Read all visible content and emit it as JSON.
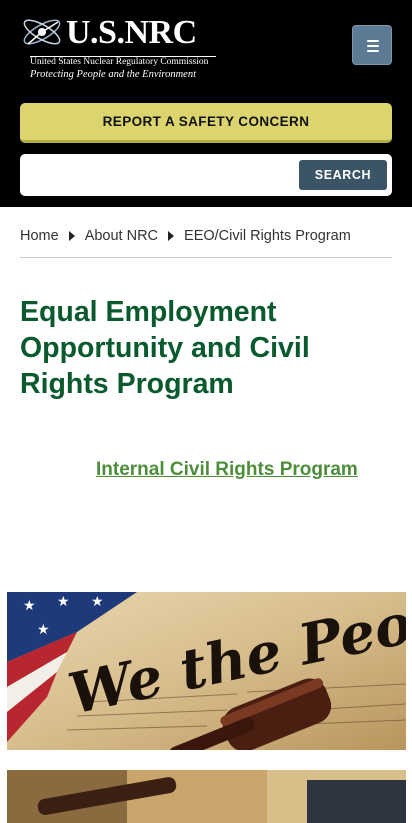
{
  "header": {
    "logo": {
      "wordmark": "U.S.NRC",
      "line1": "United States Nuclear Regulatory Commission",
      "line2": "Protecting People and the Environment"
    },
    "menu_icon": "hamburger-icon",
    "report_label": "REPORT A SAFETY CONCERN",
    "search": {
      "value": "",
      "placeholder": "",
      "button_label": "SEARCH"
    }
  },
  "breadcrumb": [
    "Home",
    "About NRC",
    "EEO/Civil Rights Program"
  ],
  "main": {
    "title": "Equal Employment Opportunity and Civil Rights Program",
    "link_label": "Internal Civil Rights Program",
    "images": [
      {
        "name": "we-the-people-banner",
        "text": "We the People"
      },
      {
        "name": "gavel-desk-banner"
      }
    ]
  },
  "colors": {
    "header_bg": "#000000",
    "report_bg": "#dcd56e",
    "search_button": "#3b5566",
    "menu_button": "#5d7a94",
    "title": "#0a5a2e",
    "link": "#4d8e3b"
  }
}
